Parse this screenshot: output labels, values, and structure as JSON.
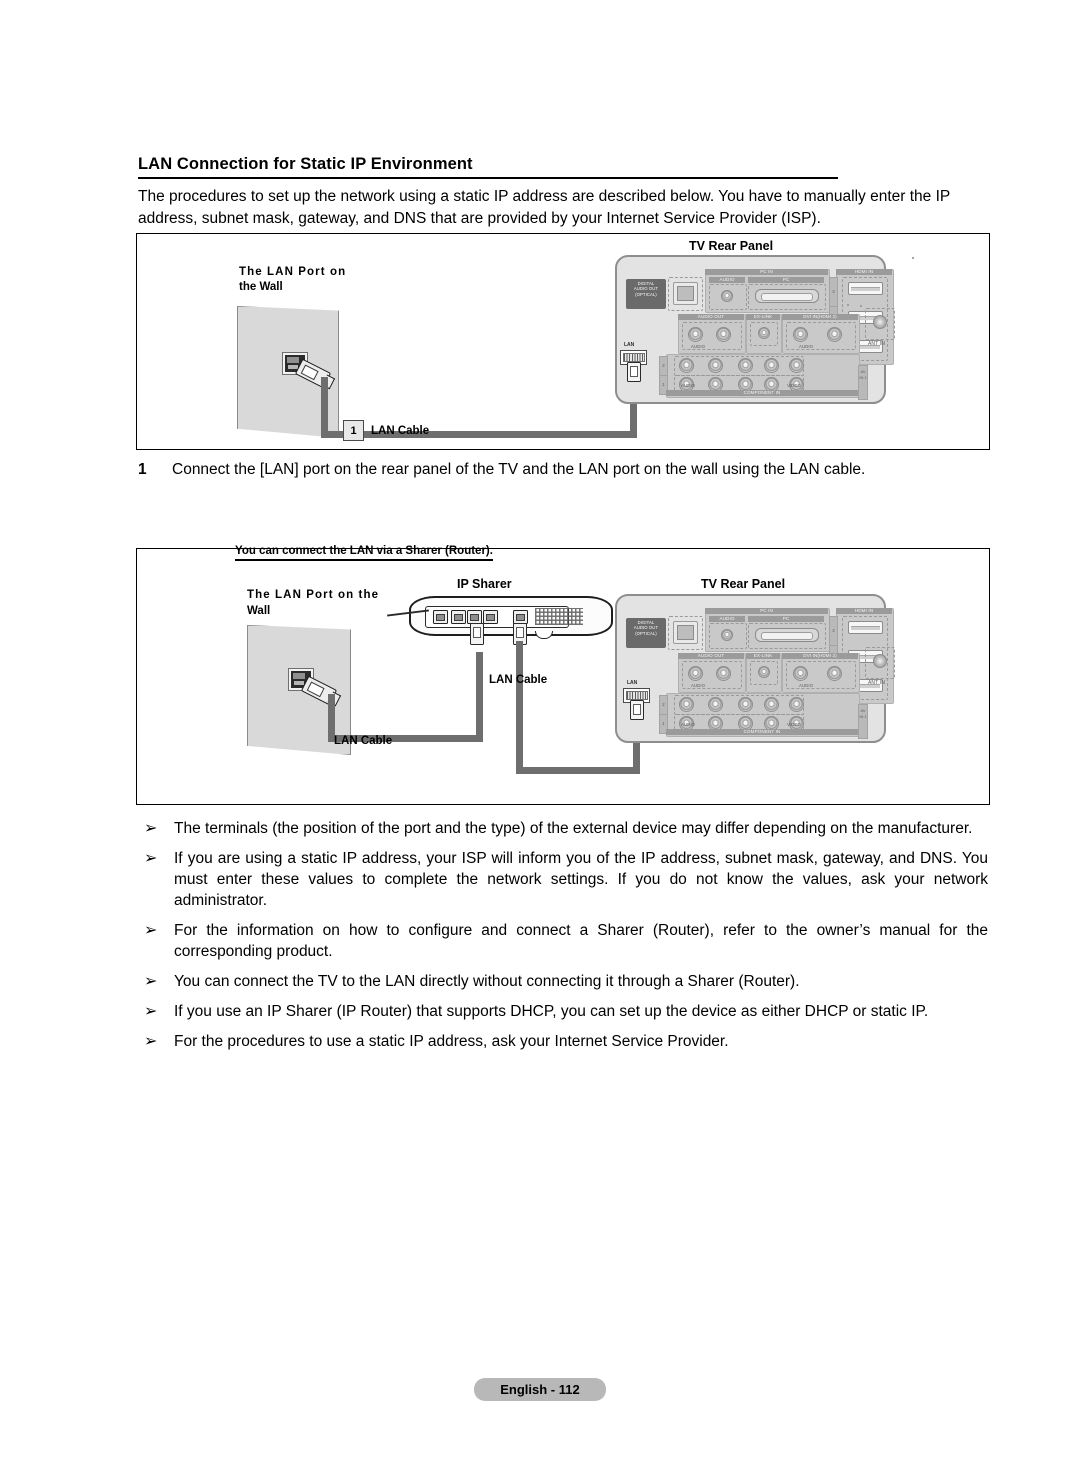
{
  "section": {
    "title": "LAN Connection for Static IP Environment",
    "intro": "The procedures to set up the network using a static IP address are described below. You have to manually enter the IP address, subnet mask, gateway, and DNS that are provided by your Internet Service Provider (ISP)."
  },
  "figure1": {
    "wall_label": "The LAN Port on\nthe Wall",
    "wall_label_line1": "The LAN Port on",
    "wall_label_line2": "the Wall",
    "tv_label": "TV Rear Panel",
    "callout_number": "1",
    "callout_label": "LAN Cable"
  },
  "step1": {
    "number": "1",
    "text": "Connect the [LAN] port on the rear panel of the TV and the LAN port on the wall using the LAN cable."
  },
  "figure2": {
    "banner": "You can connect the LAN via a Sharer (Router).",
    "wall_label_line1": "The LAN Port on the",
    "wall_label_line2": "Wall",
    "sharer_label": "IP Sharer",
    "tv_label": "TV Rear Panel",
    "cable_label_wall": "LAN Cable",
    "cable_label_tv": "LAN Cable"
  },
  "tv_panel_ports": {
    "digital_audio_out": "DIGITAL\nAUDIO OUT\n(OPTICAL)",
    "digital_audio_out_l1": "DIGITAL",
    "digital_audio_out_l2": "AUDIO OUT",
    "digital_audio_out_l3": "(OPTICAL)",
    "pc_in": "PC IN",
    "audio": "AUDIO",
    "pc": "PC",
    "hdmi_in": "HDMI IN",
    "hdmi_3": "3",
    "hdmi_2": "2",
    "hdmi_1": "1",
    "ant_in": "ANT IN",
    "audio_out": "AUDIO OUT",
    "ex_link": "EX-LINK",
    "dvi_in_hdmi2": "DVI IN(HDMI 2)",
    "audio_lr_left": "AUDIO",
    "audio_lr_right": "AUDIO",
    "component_in": "COMPONENT IN",
    "component_audio": "AUDIO",
    "video": "VIDEO",
    "av_in_1": "AV IN 1",
    "row_2": "2",
    "row_1": "1",
    "lan": "LAN"
  },
  "notes": [
    "The terminals (the position of the port and the type) of the external device may differ depending on the manufacturer.",
    "If you are using a static IP address, your ISP will inform you of the IP address, subnet mask, gateway, and DNS. You must enter these values to complete the network settings. If you do not know the values, ask your network administrator.",
    "For the information on how to configure and connect a Sharer (Router), refer to the owner’s manual for the corresponding product.",
    "You can connect the TV to the LAN directly without connecting it through a Sharer (Router).",
    "If you use an IP Sharer (IP Router) that supports DHCP, you can set up the device as either DHCP or static IP.",
    "For the procedures to use a static IP address, ask your Internet Service Provider."
  ],
  "note_marker": "➢",
  "footer": {
    "page_label": "English - 112"
  }
}
